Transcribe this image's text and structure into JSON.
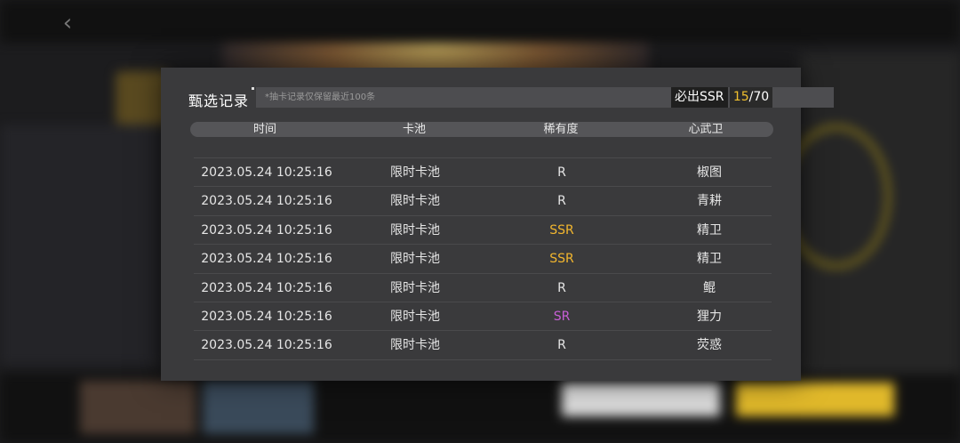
{
  "background": {
    "back_icon": "chevron-left-icon"
  },
  "modal": {
    "title": "甄选记录",
    "notice": "*抽卡记录仅保留最近100条",
    "pity": {
      "label": "必出SSR",
      "current": "15",
      "separator": "/",
      "max": "70"
    },
    "columns": [
      "时间",
      "卡池",
      "稀有度",
      "心武卫"
    ],
    "rows": [
      {
        "time": "2023.05.24  10:25:16",
        "pool": "限时卡池",
        "rarity": "R",
        "name": "椒图"
      },
      {
        "time": "2023.05.24  10:25:16",
        "pool": "限时卡池",
        "rarity": "R",
        "name": "青耕"
      },
      {
        "time": "2023.05.24  10:25:16",
        "pool": "限时卡池",
        "rarity": "SSR",
        "name": "精卫"
      },
      {
        "time": "2023.05.24  10:25:16",
        "pool": "限时卡池",
        "rarity": "SSR",
        "name": "精卫"
      },
      {
        "time": "2023.05.24  10:25:16",
        "pool": "限时卡池",
        "rarity": "R",
        "name": "鲲"
      },
      {
        "time": "2023.05.24  10:25:16",
        "pool": "限时卡池",
        "rarity": "SR",
        "name": "狸力"
      },
      {
        "time": "2023.05.24  10:25:16",
        "pool": "限时卡池",
        "rarity": "R",
        "name": "荧惑"
      }
    ]
  },
  "colors": {
    "R": "#e6e6e6",
    "SR": "#c75fd6",
    "SSR": "#f2b62e",
    "pity_current": "#f2c12e"
  }
}
